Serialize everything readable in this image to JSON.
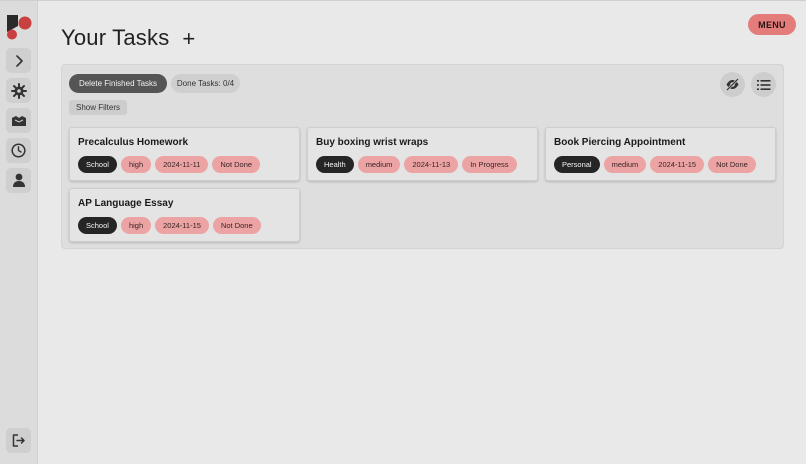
{
  "header": {
    "title": "Your Tasks",
    "add_symbol": "+",
    "menu_label": "MENU"
  },
  "toolbar": {
    "delete_label": "Delete Finished Tasks",
    "done_label": "Done Tasks: 0/4",
    "filters_label": "Show Filters"
  },
  "sidebar": {
    "icons": [
      "chevron-right-icon",
      "gear-icon",
      "inbox-icon",
      "clock-icon",
      "user-icon"
    ],
    "bottom_icon": "logout-icon"
  },
  "colors": {
    "menu": "#e57c7c",
    "tag_pink": "#eba3a3",
    "tag_dark": "#252525",
    "logo_red": "#c94040"
  },
  "tasks": [
    {
      "title": "Precalculus Homework",
      "category": "School",
      "priority": "high",
      "date": "2024-11-11",
      "status": "Not Done"
    },
    {
      "title": "Buy boxing wrist wraps",
      "category": "Health",
      "priority": "medium",
      "date": "2024-11-13",
      "status": "In Progress"
    },
    {
      "title": "Book Piercing Appointment",
      "category": "Personal",
      "priority": "medium",
      "date": "2024-11-15",
      "status": "Not Done"
    },
    {
      "title": "AP Language Essay",
      "category": "School",
      "priority": "high",
      "date": "2024-11-15",
      "status": "Not Done"
    }
  ]
}
